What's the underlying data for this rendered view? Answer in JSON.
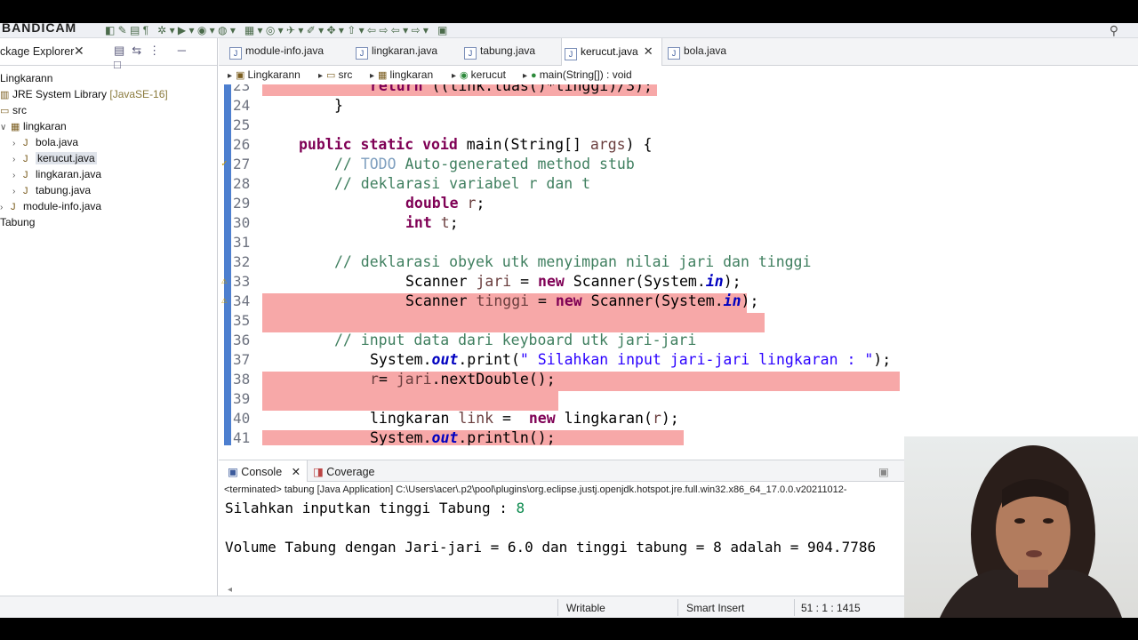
{
  "toolbar": {
    "logo": "BANDICAM",
    "search_icon": "search-icon"
  },
  "explorer": {
    "title": "ckage Explorer",
    "close": "✕",
    "items": [
      {
        "label": "Lingkarann",
        "extra": ""
      },
      {
        "label": "JRE System Library",
        "extra": "[JavaSE-16]"
      },
      {
        "label": "src",
        "extra": ""
      },
      {
        "label": "lingkaran",
        "extra": ""
      },
      {
        "label": "bola.java",
        "extra": ""
      },
      {
        "label": "kerucut.java",
        "extra": ""
      },
      {
        "label": "lingkaran.java",
        "extra": ""
      },
      {
        "label": "tabung.java",
        "extra": ""
      },
      {
        "label": "module-info.java",
        "extra": ""
      },
      {
        "label": "Tabung",
        "extra": ""
      }
    ]
  },
  "editor": {
    "tabs": [
      "module-info.java",
      "lingkaran.java",
      "tabung.java",
      "kerucut.java",
      "bola.java"
    ],
    "active_tab": "kerucut.java",
    "breadcrumb": [
      "Lingkarann",
      "src",
      "lingkaran",
      "kerucut",
      "main(String[]) : void"
    ],
    "line_numbers": [
      "23",
      "24",
      "25",
      "26",
      "27",
      "28",
      "29",
      "30",
      "31",
      "32",
      "33",
      "34",
      "35",
      "36",
      "37",
      "38",
      "39",
      "40",
      "41"
    ]
  },
  "console": {
    "tab_console": "Console",
    "tab_coverage": "Coverage",
    "terminated": "<terminated> tabung [Java Application] C:\\Users\\acer\\.p2\\pool\\plugins\\org.eclipse.justj.openjdk.hotspot.jre.full.win32.x86_64_17.0.0.v20211012-",
    "prompt": "Silahkan inputkan tinggi Tabung : ",
    "prompt_input": "8",
    "result": "Volume Tabung dengan Jari-jari = 6.0 dan tinggi tabung = 8 adalah = 904.7786"
  },
  "status": {
    "writable": "Writable",
    "insert_mode": "Smart Insert",
    "position": "51 : 1 : 1415"
  }
}
